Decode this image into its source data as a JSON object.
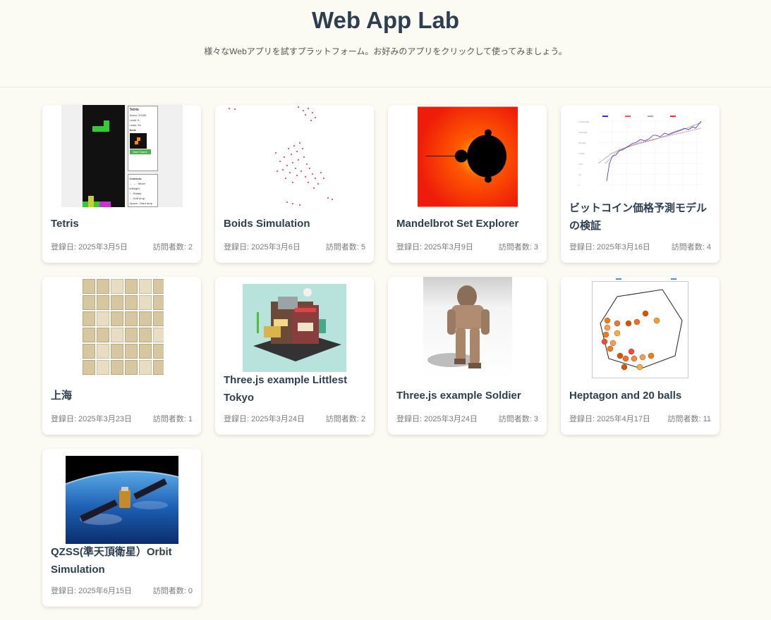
{
  "header": {
    "title": "Web App Lab",
    "subtitle": "様々なWebアプリを試すプラットフォーム。お好みのアプリをクリックして使ってみましょう。"
  },
  "apps": [
    {
      "title": "Tetris",
      "date": "登録日: 2025年3月5日",
      "visits": "訪問者数: 2",
      "thumb_icon": "tetris-screenshot",
      "thumb_text": {
        "name": "Tetris",
        "score": "Score: 20180",
        "level": "Level: 6",
        "lines": "Lines: 54",
        "next": "Next:",
        "button": "Start Game",
        "controls": "Controls:",
        "c1": "← → : Move left/right",
        "c2": "↑ : Rotate",
        "c3": "↓ : Soft drop",
        "c4": "Space : Hard drop"
      }
    },
    {
      "title": "Boids Simulation",
      "date": "登録日: 2025年3月6日",
      "visits": "訪問者数: 5",
      "thumb_icon": "boids-screenshot"
    },
    {
      "title": "Mandelbrot Set Explorer",
      "date": "登録日: 2025年3月9日",
      "visits": "訪問者数: 3",
      "thumb_icon": "mandelbrot-screenshot"
    },
    {
      "title": "ビットコイン価格予測モデルの検証",
      "date": "登録日: 2025年3月16日",
      "visits": "訪問者数: 4",
      "thumb_icon": "bitcoin-chart-screenshot"
    },
    {
      "title": "上海",
      "date": "登録日: 2025年3月23日",
      "visits": "訪問者数: 1",
      "thumb_icon": "mahjong-tiles-screenshot"
    },
    {
      "title": "Three.js example Littlest Tokyo",
      "date": "登録日: 2025年3月24日",
      "visits": "訪問者数: 2",
      "thumb_icon": "tokyo-building-screenshot"
    },
    {
      "title": "Three.js example Soldier",
      "date": "登録日: 2025年3月24日",
      "visits": "訪問者数: 3",
      "thumb_icon": "soldier-screenshot"
    },
    {
      "title": "Heptagon and 20 balls",
      "date": "登録日: 2025年4月17日",
      "visits": "訪問者数: 11",
      "thumb_icon": "heptagon-balls-screenshot"
    },
    {
      "title": "QZSS(準天頂衛星）Orbit Simulation",
      "date": "登録日: 2025年6月15日",
      "visits": "訪問者数: 0",
      "thumb_icon": "satellite-screenshot"
    }
  ],
  "colors": {
    "background": "#fbfbf3",
    "title": "#2c3e50",
    "meta": "#7a7a7a"
  }
}
